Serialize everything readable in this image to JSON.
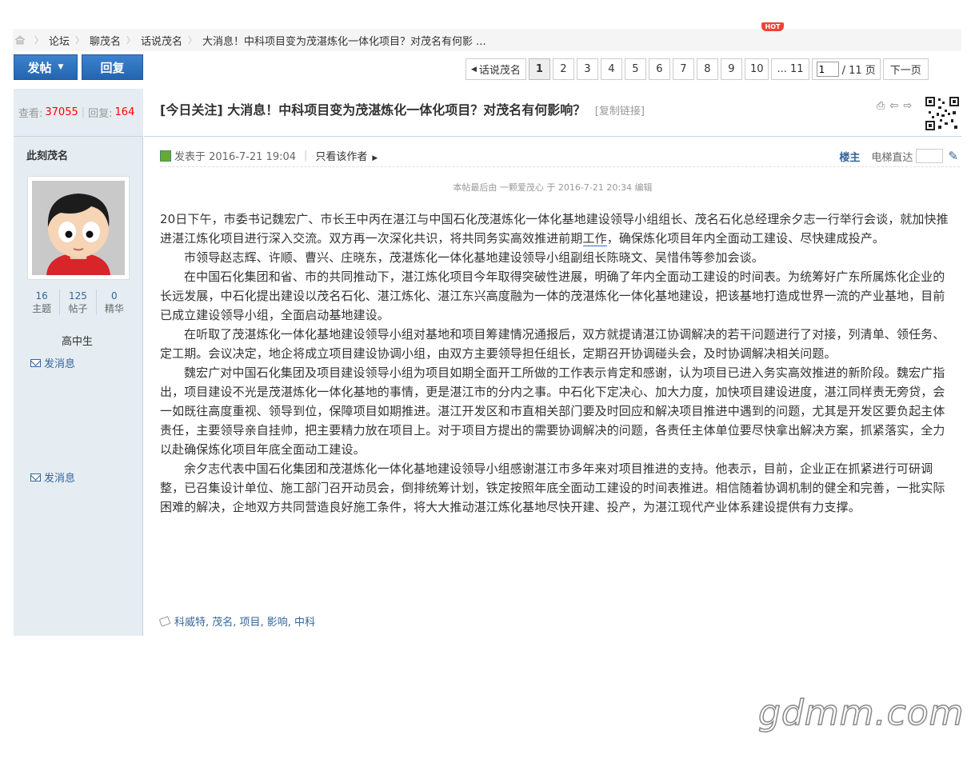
{
  "breadcrumb": {
    "items": [
      "论坛",
      "聊茂名",
      "话说茂名",
      "大消息！中科项目变为茂湛炼化一体化项目？对茂名有何影 ..."
    ],
    "hot_badge": "HOT"
  },
  "toolbar": {
    "post_label": "发帖",
    "reply_label": "回复"
  },
  "pager": {
    "back_label": "话说茂名",
    "pages": [
      "1",
      "2",
      "3",
      "4",
      "5",
      "6",
      "7",
      "8",
      "9",
      "10",
      "... 11"
    ],
    "current_page": "1",
    "page_input_value": "1",
    "total_label": "/ 11 页",
    "next_label": "下一页"
  },
  "thread_stats": {
    "views_label": "查看:",
    "views": "37055",
    "sep": "|",
    "replies_label": "回复:",
    "replies": "164"
  },
  "author": {
    "name": "此刻茂名",
    "threads": "16",
    "threads_label": "主题",
    "posts": "125",
    "posts_label": "帖子",
    "digest": "0",
    "digest_label": "精华",
    "rank": "高中生",
    "message_label": "发消息",
    "message_label_2": "发消息"
  },
  "post": {
    "title": "[今日关注] 大消息！中科项目变为茂湛炼化一体化项目？对茂名有何影响？",
    "copy_link": "[复制链接]",
    "posted_at": "发表于 2016-7-21 19:04",
    "only_author": "只看该作者",
    "floor_label": "楼主",
    "elevator_label": "电梯直达",
    "edit_note": "本帖最后由 一颗爱茂心 于 2016-7-21 20:34 编辑",
    "paragraphs": [
      "20日下午，市委书记魏宏广、市长王中丙在湛江与中国石化茂湛炼化一体化基地建设领导小组组长、茂名石化总经理余夕志一行举行会谈，就加快推进湛江炼化项目进行深入交流。双方再一次深化共识，将共同务实高效推进前期",
      "市领导赵志辉、许顺、曹兴、庄晓东，茂湛炼化一体化基地建设领导小组副组长陈晓文、吴惜伟等参加会谈。",
      "在中国石化集团和省、市的共同推动下，湛江炼化项目今年取得突破性进展，明确了年内全面动工建设的时间表。为统筹好广东所属炼化企业的长远发展，中石化提出建设以茂名石化、湛江炼化、湛江东兴高度融为一体的茂湛炼化一体化基地建设，把该基地打造成世界一流的产业基地，目前已成立建设领导小组，全面启动基地建设。",
      "在听取了茂湛炼化一体化基地建设领导小组对基地和项目筹建情况通报后，双方就提请湛江协调解决的若干问题进行了对接，列清单、领任务、定工期。会议决定，地企将成立项目建设协调小组，由双方主要领导担任组长，定期召开协调碰头会，及时协调解决相关问题。",
      "魏宏广对中国石化集团及项目建设领导小组为项目如期全面开工所做的工作表示肯定和感谢，认为项目已进入务实高效推进的新阶段。魏宏广指出，项目建设不光是茂湛炼化一体化基地的事情，更是湛江市的分内之事。中石化下定决心、加大力度，加快项目建设进度，湛江同样责无旁贷，会一如既往高度重视、领导到位，保障项目如期推进。湛江开发区和市直相关部门要及时回应和解决项目推进中遇到的问题，尤其是开发区要负起主体责任，主要领导亲自挂帅，把主要精力放在项目上。对于项目方提出的需要协调解决的问题，各责任主体单位要尽快拿出解决方案，抓紧落实，全力以赴确保炼化项目年底全面动工建设。",
      "余夕志代表中国石化集团和茂湛炼化一体化基地建设领导小组感谢湛江市多年来对项目推进的支持。他表示，目前，企业正在抓紧进行可研调整，已召集设计单位、施工部门召开动员会，倒排统筹计划，铁定按照年底全面动工建设的时间表推进。相信随着协调机制的健全和完善，一批实际困难的解决，企地双方共同营造良好施工条件，将大大推动湛江炼化基地尽快开建、投产，为湛江现代产业体系建设提供有力支撑。"
    ],
    "p1_link": "工作",
    "p1_tail": "，确保炼化项目年内全面动工建设、尽快建成投产。",
    "tags": "科威特, 茂名, 项目, 影响, 中科"
  },
  "watermark": "gdmm.com",
  "icons": [
    "home-icon",
    "print-icon",
    "prev-thread-icon",
    "next-thread-icon",
    "qr-code-icon",
    "post-icon",
    "mail-icon",
    "tag-icon",
    "wrench-icon"
  ]
}
